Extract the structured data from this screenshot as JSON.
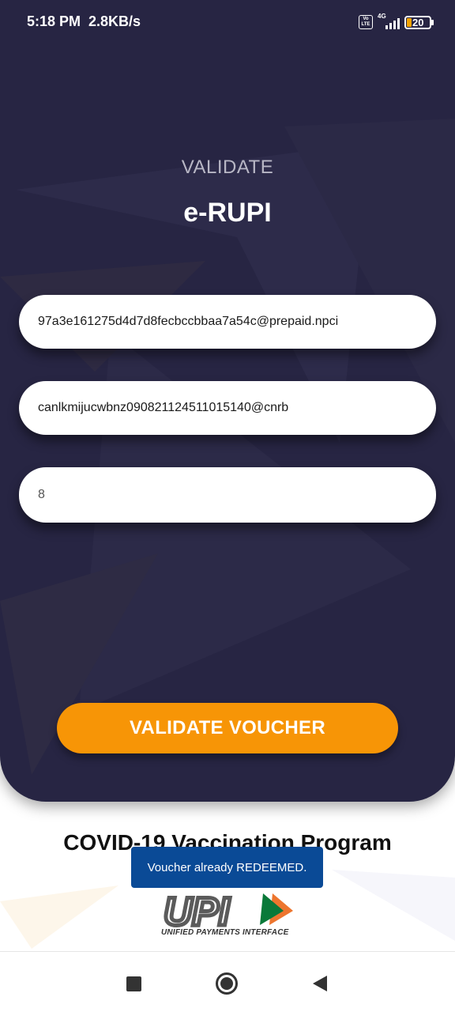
{
  "status_bar": {
    "time": "5:18 PM",
    "speed": "2.8KB/s",
    "network": "4G",
    "volte": "Vo LTE",
    "battery": "20"
  },
  "header": {
    "subtitle": "VALIDATE",
    "title": "e-RUPI"
  },
  "form": {
    "field_1_value": "97a3e161275d4d7d8fecbccbbaa7a54c@prepaid.npci",
    "field_2_value": "canlkmijucwbnz090821124511015140@cnrb",
    "field_3_value": "8"
  },
  "validate_button_label": "VALIDATE VOUCHER",
  "program_title": "COVID-19 Vaccination Program",
  "toast_message": "Voucher already REDEEMED.",
  "upi": {
    "logo_text": "UPI",
    "caption": "UNIFIED PAYMENTS INTERFACE"
  },
  "colors": {
    "panel": "#272543",
    "accent": "#f79506",
    "toast": "#0a4a96"
  },
  "icons": [
    "recents-icon",
    "home-icon",
    "back-icon"
  ]
}
